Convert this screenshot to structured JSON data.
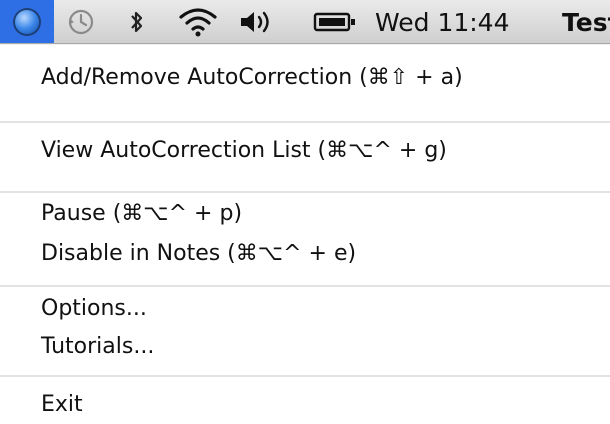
{
  "menubar": {
    "app_icon": "autocorrection-app-icon",
    "status_icons": [
      "time-machine-icon",
      "bluetooth-icon",
      "wifi-icon",
      "volume-icon",
      "battery-icon"
    ],
    "clock": "Wed 11:44",
    "user": "Test"
  },
  "menu": {
    "items": [
      {
        "label": "Add/Remove AutoCorrection (⌘⇧ + a)"
      },
      {
        "label": "View AutoCorrection List (⌘⌥^ + g)"
      },
      {
        "label": "Pause (⌘⌥^ + p)"
      },
      {
        "label": "Disable in Notes (⌘⌥^ + e)"
      },
      {
        "label": "Options..."
      },
      {
        "label": "Tutorials..."
      },
      {
        "label": "Exit"
      }
    ]
  },
  "colors": {
    "menubar_highlight": "#2f6fe6",
    "menu_background": "#ffffff",
    "separator": "#e2e2e2"
  }
}
